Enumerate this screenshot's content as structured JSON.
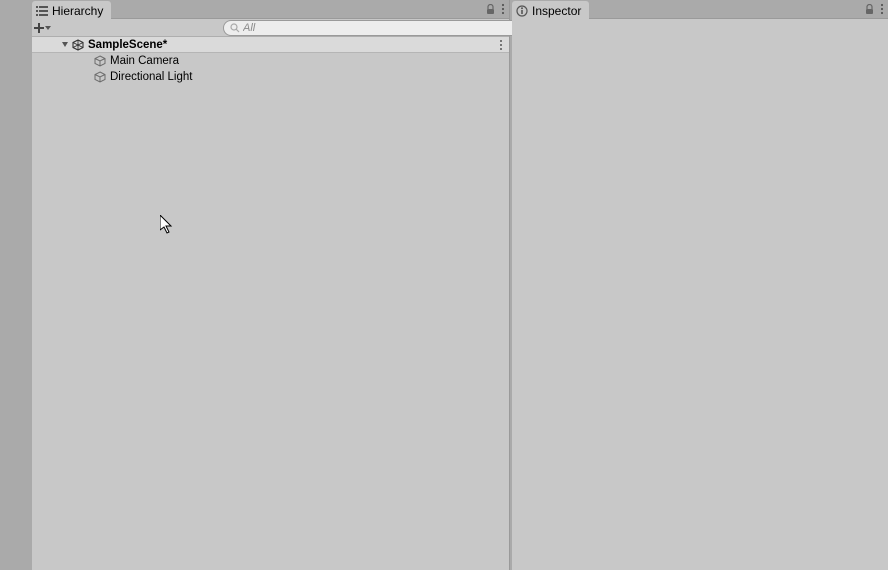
{
  "hierarchy": {
    "tab_label": "Hierarchy",
    "search_placeholder": "All",
    "scene": {
      "name": "SampleScene*",
      "objects": [
        {
          "name": "Main Camera"
        },
        {
          "name": "Directional Light"
        }
      ]
    }
  },
  "inspector": {
    "tab_label": "Inspector"
  }
}
